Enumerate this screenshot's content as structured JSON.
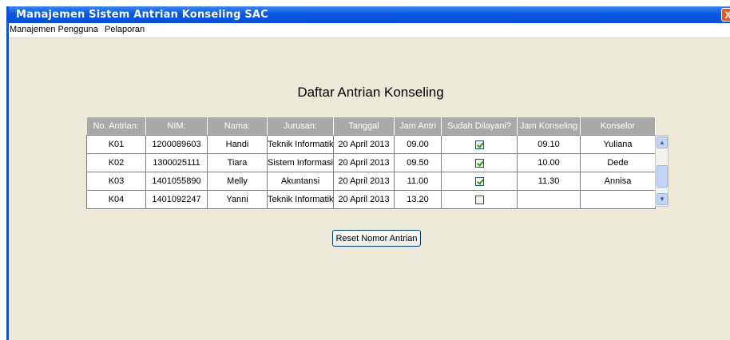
{
  "window": {
    "title": "Manajemen Sistem Antrian Konseling SAC",
    "close_label": "X"
  },
  "menu": {
    "items": [
      "Manajemen Pengguna",
      "Pelaporan"
    ]
  },
  "heading": "Daftar Antrian Konseling",
  "table": {
    "columns": [
      "No. Antrian:",
      "NIM:",
      "Nama:",
      "Jurusan:",
      "Tanggal",
      "Jam Antri",
      "Sudah Dilayani?",
      "Jam Konseling",
      "Konselor"
    ],
    "rows": [
      {
        "no": "K01",
        "nim": "1200089603",
        "nama": "Handi",
        "jurusan": "Teknik Informatika",
        "tanggal": "20 April 2013",
        "jam_antri": "09.00",
        "sudah_dilayani": true,
        "jam_konseling": "09.10",
        "konselor": "Yuliana"
      },
      {
        "no": "K02",
        "nim": "1300025111",
        "nama": "Tiara",
        "jurusan": "Sistem Informasi",
        "tanggal": "20 April 2013",
        "jam_antri": "09.50",
        "sudah_dilayani": true,
        "jam_konseling": "10.00",
        "konselor": "Dede"
      },
      {
        "no": "K03",
        "nim": "1401055890",
        "nama": "Melly",
        "jurusan": "Akuntansi",
        "tanggal": "20 April 2013",
        "jam_antri": "11.00",
        "sudah_dilayani": true,
        "jam_konseling": "11.30",
        "konselor": "Annisa"
      },
      {
        "no": "K04",
        "nim": "1401092247",
        "nama": "Yanni",
        "jurusan": "Teknik Informatika",
        "tanggal": "20 April 2013",
        "jam_antri": "13.20",
        "sudah_dilayani": false,
        "jam_konseling": "",
        "konselor": ""
      }
    ]
  },
  "reset_button": {
    "label": "Reset Nomor Antrian"
  },
  "icons": {
    "close": "close-icon",
    "scroll_up": "chevron-up-icon",
    "scroll_down": "chevron-down-icon"
  },
  "colors": {
    "titlebar": "#0a57e0",
    "header_bg": "#a8a8a8",
    "checkbox_check": "#21a121",
    "close_button": "#e2582c"
  }
}
